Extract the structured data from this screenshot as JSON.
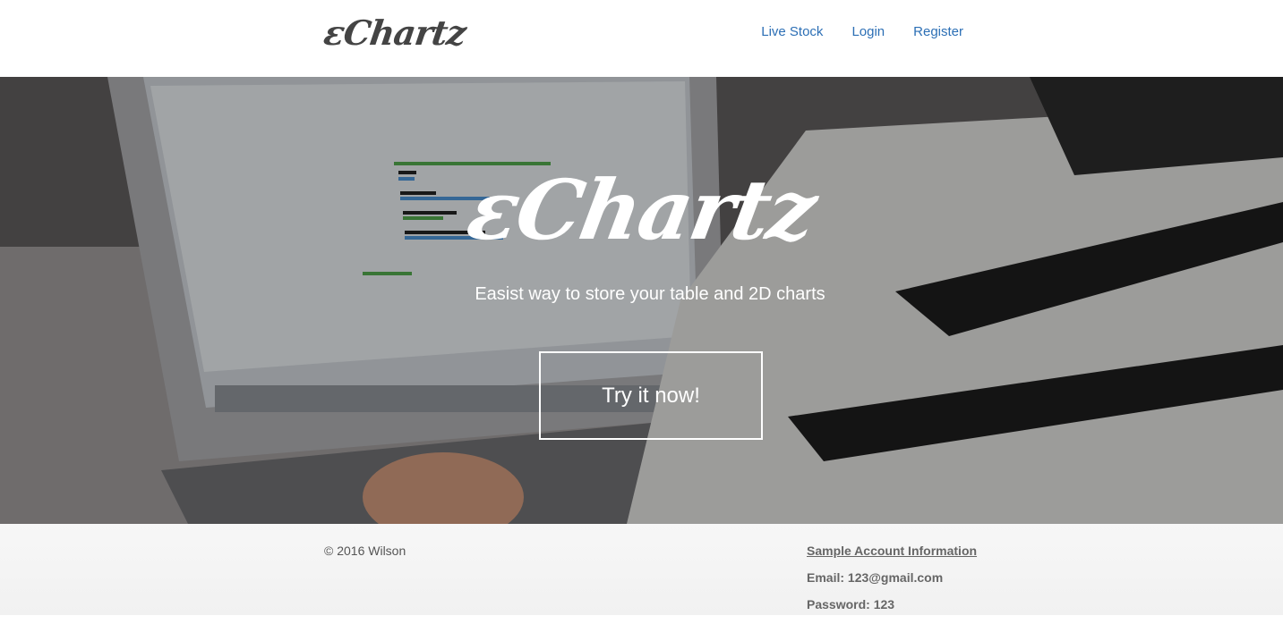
{
  "navbar": {
    "brand": "εChartz",
    "links": [
      "Live Stock",
      "Login",
      "Register"
    ]
  },
  "hero": {
    "title": "εChartz",
    "subtitle": "Easist way to store your table and 2D charts",
    "cta_label": "Try it now!"
  },
  "footer": {
    "copyright": "© 2016 Wilson",
    "account_title": "Sample Account Information",
    "email": "Email: 123@gmail.com",
    "password": "Password: 123"
  },
  "colors": {
    "link": "#2c6fb5",
    "hero_text": "#ffffff"
  }
}
